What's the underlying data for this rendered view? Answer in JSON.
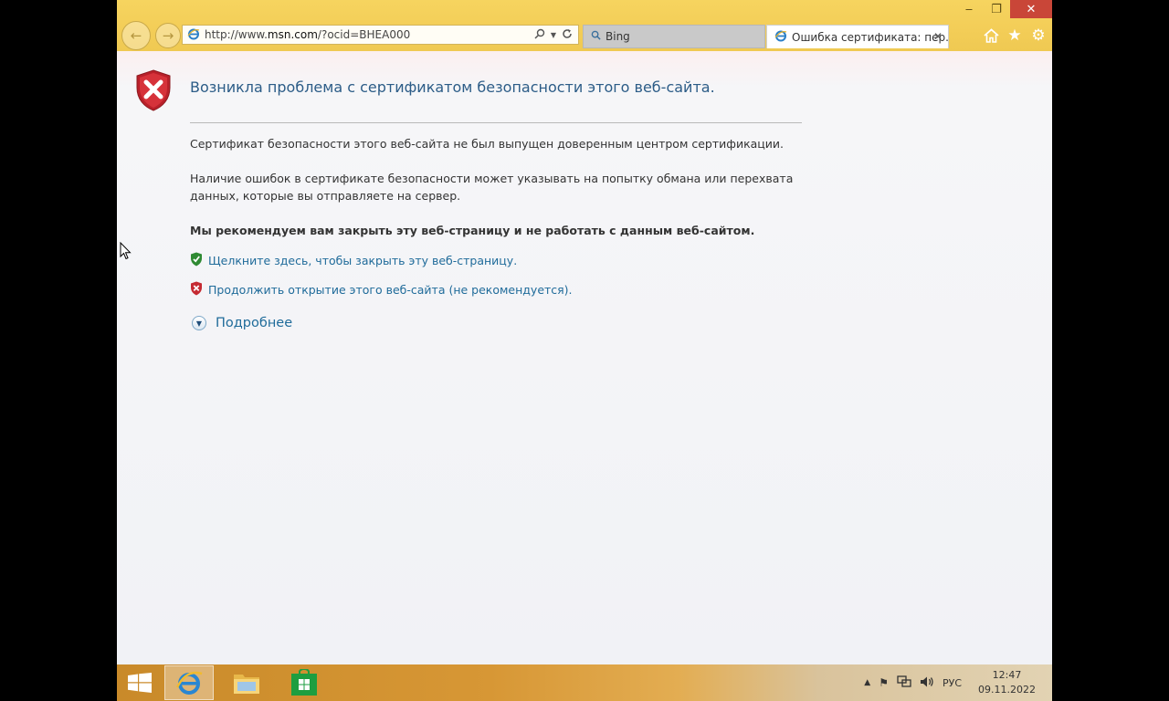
{
  "window": {
    "minimize_glyph": "‒",
    "restore_glyph": "❐",
    "close_glyph": "✕"
  },
  "address_bar": {
    "url_prefix": "http://www.",
    "url_domain": "msn.com",
    "url_rest": "/?ocid=BHEA000"
  },
  "tabs": [
    {
      "label": "Bing",
      "icon": "search-icon"
    },
    {
      "label": "Ошибка сертификата: пер...",
      "icon": "ie-icon",
      "close": "✕"
    }
  ],
  "page": {
    "title": "Возникла проблема с сертификатом безопасности этого веб-сайта.",
    "paragraph1": "Сертификат безопасности этого веб-сайта не был выпущен доверенным центром сертификации.",
    "paragraph2": "Наличие ошибок в сертификате безопасности может указывать на попытку обмана или перехвата данных, которые вы отправляете на сервер.",
    "recommendation": "Мы рекомендуем вам закрыть эту веб-страницу и не работать с данным веб-сайтом.",
    "link_close": "Щелкните здесь, чтобы закрыть эту веб-страницу.",
    "link_continue": "Продолжить открытие этого веб-сайта (не рекомендуется).",
    "more_info": "Подробнее"
  },
  "taskbar": {
    "language": "РУС",
    "time": "12:47",
    "date": "09.11.2022"
  },
  "colors": {
    "chrome": "#f3cd57",
    "title_text": "#2c5c87",
    "link": "#1f6b9a",
    "close_button": "#c94638"
  }
}
